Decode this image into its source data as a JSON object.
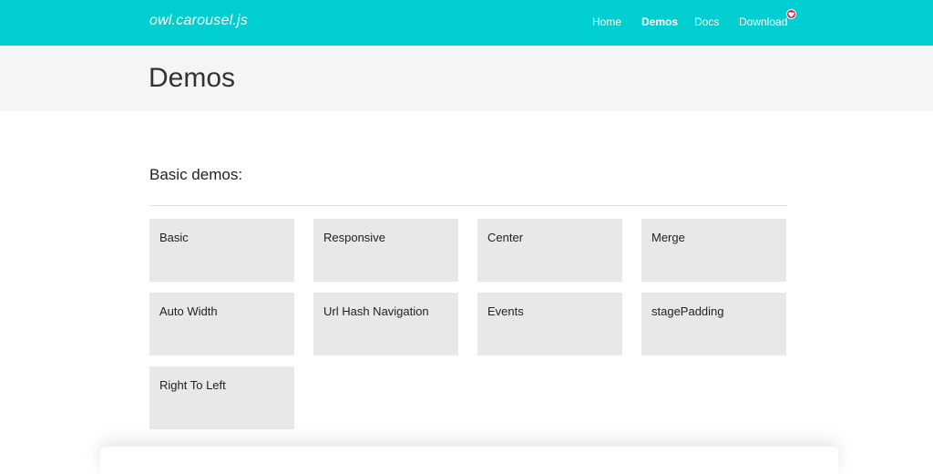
{
  "header": {
    "brand": "owl.carousel.js",
    "nav": [
      {
        "label": "Home",
        "active": false
      },
      {
        "label": "Demos",
        "active": true
      },
      {
        "label": "Docs",
        "active": false
      },
      {
        "label": "Download",
        "active": false
      }
    ],
    "download_badge_icon": "heart-icon",
    "badge_color": "#e6184a",
    "accent_color": "#00ced1"
  },
  "page": {
    "title": "Demos"
  },
  "section": {
    "title": "Basic demos:",
    "demos": [
      "Basic",
      "Responsive",
      "Center",
      "Merge",
      "Auto Width",
      "Url Hash Navigation",
      "Events",
      "stagePadding",
      "Right To Left"
    ]
  }
}
